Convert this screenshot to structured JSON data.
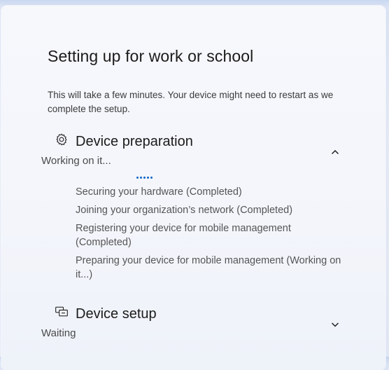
{
  "title": "Setting up for work or school",
  "subtitle": "This will take a few minutes. Your device might need to restart as we complete the setup.",
  "sections": [
    {
      "title": "Device preparation",
      "icon": "gear-icon",
      "status": "Working on it...",
      "expanded": true,
      "steps": [
        "Securing your hardware (Completed)",
        "Joining your organization’s network (Completed)",
        "Registering your device for mobile management (Completed)",
        "Preparing your device for mobile management (Working on it...)"
      ]
    },
    {
      "title": "Device setup",
      "icon": "device-setup-icon",
      "status": "Waiting",
      "expanded": false
    }
  ],
  "colors": {
    "accent": "#0a64c8",
    "text": "#1b1b1b",
    "muted": "#555555"
  }
}
